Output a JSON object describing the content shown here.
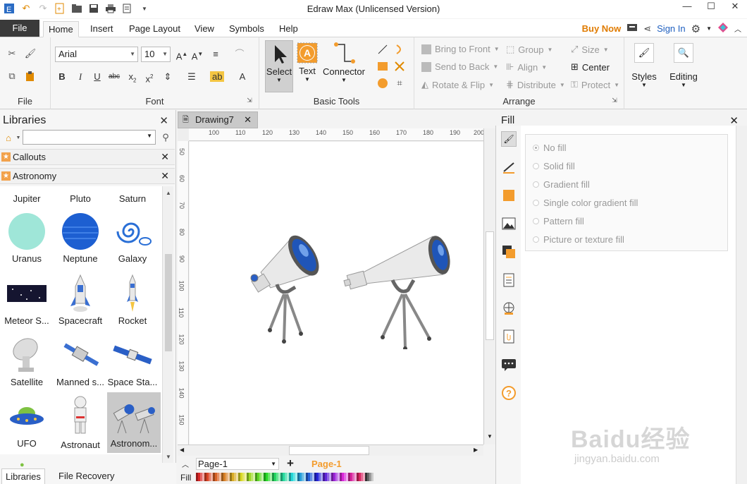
{
  "window": {
    "title": "Edraw Max (Unlicensed Version)"
  },
  "menu": {
    "file": "File",
    "tabs": [
      "Home",
      "Insert",
      "Page Layout",
      "View",
      "Symbols",
      "Help"
    ],
    "buy_now": "Buy Now",
    "sign_in": "Sign In"
  },
  "ribbon": {
    "groups": {
      "file": "File",
      "font": "Font",
      "basic_tools": "Basic Tools",
      "arrange": "Arrange"
    },
    "font_name": "Arial",
    "font_size": "10",
    "select": "Select",
    "text": "Text",
    "connector": "Connector",
    "arrange": {
      "bring_to_front": "Bring to Front",
      "send_to_back": "Send to Back",
      "rotate_flip": "Rotate & Flip",
      "group": "Group",
      "align": "Align",
      "distribute": "Distribute",
      "size": "Size",
      "center": "Center",
      "protect": "Protect"
    },
    "styles": "Styles",
    "editing": "Editing"
  },
  "libraries": {
    "title": "Libraries",
    "categories": [
      "Callouts",
      "Astronomy"
    ],
    "shapes": [
      [
        "Jupiter",
        "Pluto",
        "Saturn"
      ],
      [
        "Uranus",
        "Neptune",
        "Galaxy"
      ],
      [
        "Meteor S...",
        "Spacecraft",
        "Rocket"
      ],
      [
        "Satellite",
        "Manned s...",
        "Space Sta..."
      ],
      [
        "UFO",
        "Astronaut",
        "Astronom..."
      ]
    ],
    "footer": {
      "libraries": "Libraries",
      "file_recovery": "File Recovery"
    }
  },
  "document": {
    "tab": "Drawing7",
    "ruler_h": [
      "100",
      "110",
      "120",
      "130",
      "140",
      "150",
      "160",
      "170",
      "180",
      "190",
      "200"
    ],
    "ruler_v": [
      "50",
      "60",
      "70",
      "80",
      "90",
      "100",
      "110",
      "120",
      "130",
      "140",
      "150"
    ],
    "page_select": "Page-1",
    "page_tab": "Page-1",
    "palette_label": "Fill"
  },
  "fill_panel": {
    "title": "Fill",
    "options": [
      "No fill",
      "Solid fill",
      "Gradient fill",
      "Single color gradient fill",
      "Pattern fill",
      "Picture or texture fill"
    ]
  },
  "watermark": {
    "brand": "Baidu经验",
    "url": "jingyan.baidu.com"
  },
  "colors": {
    "accent_orange": "#f39c2d",
    "menu_dark": "#3a3a3a",
    "link_blue": "#2060c0",
    "buy_orange": "#e07b00"
  }
}
